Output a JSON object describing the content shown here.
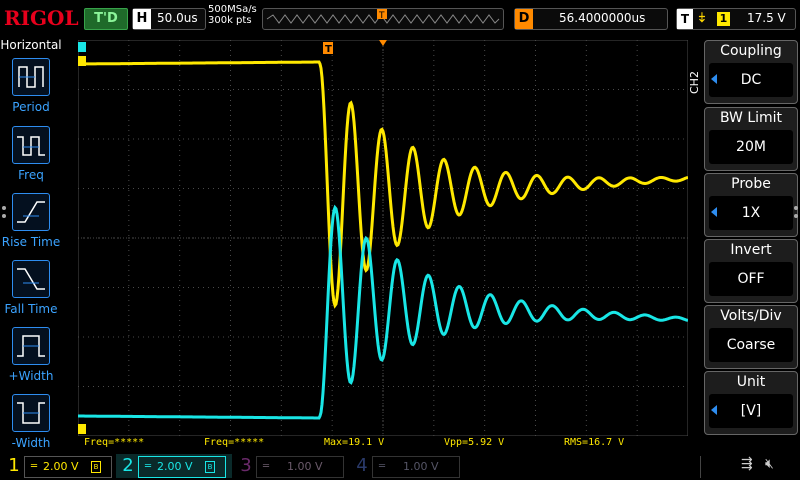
{
  "brand": "RIGOL",
  "top": {
    "trigger_state": "T'D",
    "horizontal_label": "H",
    "timebase": "50.0us",
    "sample_rate": "500MSa/s",
    "memory_depth": "300k pts",
    "delay_label": "D",
    "delay_value": "56.4000000us",
    "trigger_label": "T",
    "trigger_source": "1",
    "trigger_level": "17.5 V"
  },
  "left_menu": {
    "title": "Horizontal",
    "items": [
      {
        "label": "Period",
        "icon": "period-icon"
      },
      {
        "label": "Freq",
        "icon": "freq-icon"
      },
      {
        "label": "Rise Time",
        "icon": "rise-time-icon"
      },
      {
        "label": "Fall Time",
        "icon": "fall-time-icon"
      },
      {
        "label": "+Width",
        "icon": "positive-width-icon"
      },
      {
        "label": "-Width",
        "icon": "negative-width-icon"
      }
    ]
  },
  "right_menu": {
    "channel_tag": "CH2",
    "items": [
      {
        "header": "Coupling",
        "value": "DC",
        "has_arrow": true
      },
      {
        "header": "BW Limit",
        "value": "20M",
        "has_arrow": false
      },
      {
        "header": "Probe",
        "value": "1X",
        "has_arrow": true
      },
      {
        "header": "Invert",
        "value": "OFF",
        "has_arrow": false
      },
      {
        "header": "Volts/Div",
        "value": "Coarse",
        "has_arrow": false
      },
      {
        "header": "Unit",
        "value": "[V]",
        "has_arrow": true
      }
    ]
  },
  "measurements": {
    "freq1": "Freq=*****",
    "freq2": "Freq=*****",
    "max": "Max=19.1 V",
    "vpp": "Vpp=5.92 V",
    "rms": "RMS=16.7 V"
  },
  "channels": [
    {
      "num": "1",
      "scale": "2.00 V",
      "color": "#ffe800",
      "active": true
    },
    {
      "num": "2",
      "scale": "2.00 V",
      "color": "#19e6e6",
      "active": true
    },
    {
      "num": "3",
      "scale": "1.00 V",
      "color": "#6a2a6a",
      "active": false
    },
    {
      "num": "4",
      "scale": "1.00 V",
      "color": "#2a3a6a",
      "active": false
    }
  ],
  "colors": {
    "ch1": "#ffe800",
    "ch2": "#19e6e6",
    "menu_accent": "#2e8df0",
    "grid": "#4a4a4a",
    "delay_marker": "#ff8a00",
    "logo": "#e8001c"
  }
}
